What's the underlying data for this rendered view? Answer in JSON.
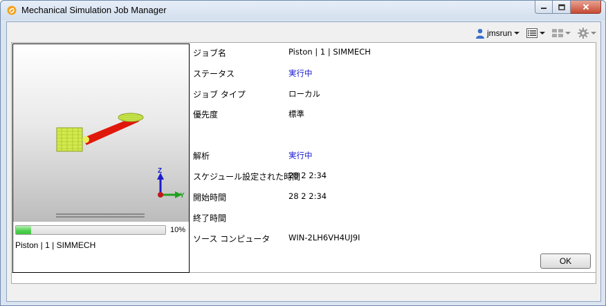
{
  "window": {
    "title": "Mechanical Simulation Job Manager"
  },
  "toolbar": {
    "user": "jmsrun",
    "icons": [
      "user-icon",
      "list-view-icon",
      "layout-icon",
      "gear-icon"
    ]
  },
  "preview": {
    "progress_percent": 10,
    "progress_label": "10%",
    "job_caption": "Piston | 1 | SIMMECH",
    "axis_labels": {
      "z": "Z",
      "y": "Y"
    }
  },
  "details": [
    {
      "label": "ジョブ名",
      "value": "Piston | 1 | SIMMECH",
      "link": false
    },
    {
      "label": "ステータス",
      "value": "実行中",
      "link": true
    },
    {
      "label": "ジョブ タイプ",
      "value": "ローカル",
      "link": false
    },
    {
      "label": "優先度",
      "value": "標準",
      "link": false
    },
    {
      "label": "解析",
      "value": "実行中",
      "link": true
    },
    {
      "label": "スケジュール設定された時間",
      "value": "28 2 2:34",
      "link": false
    },
    {
      "label": "開始時間",
      "value": "28 2 2:34",
      "link": false
    },
    {
      "label": "終了時間",
      "value": "",
      "link": false
    },
    {
      "label": "ソース コンピュータ",
      "value": "WIN-2LH6VH4UJ9I",
      "link": false
    }
  ],
  "buttons": {
    "ok": "OK"
  },
  "colors": {
    "link": "#1a1ad0",
    "progress": "#4fd04f",
    "window_frame": "#dbe5f1"
  }
}
